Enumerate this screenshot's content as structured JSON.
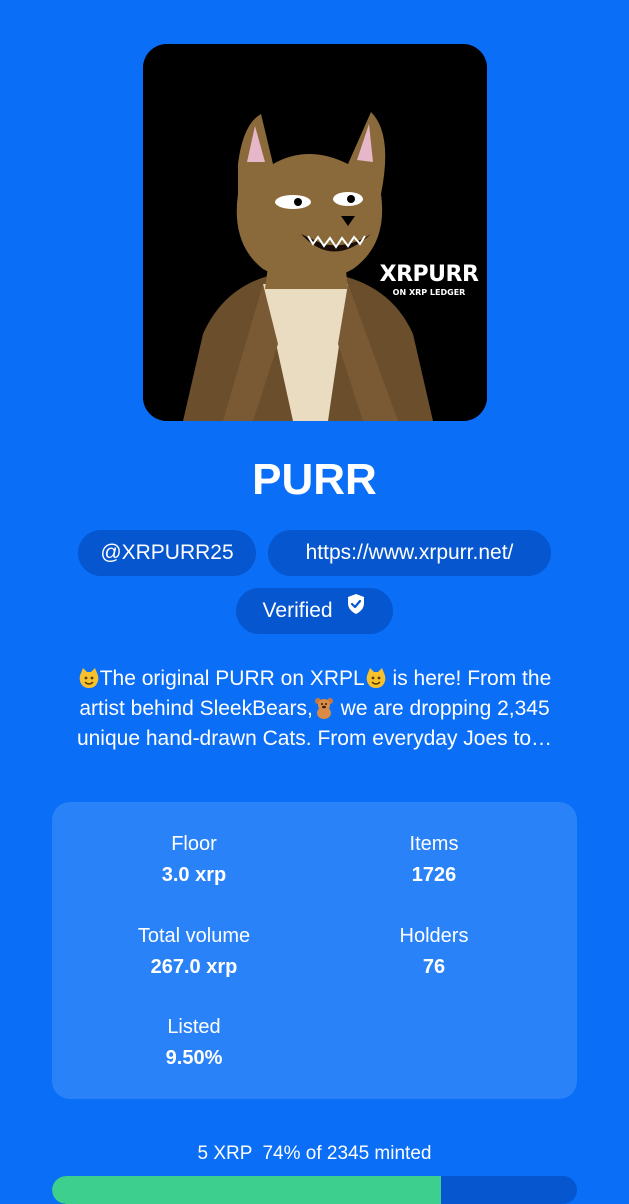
{
  "collection": {
    "image_alt": "XRPURR cat in jacket",
    "image_brand": "XRPURR",
    "image_brand_sub": "ON XRP LEDGER",
    "title": "PURR",
    "twitter": "@XRPURR25",
    "website": "https://www.xrpurr.net/",
    "verified_label": "Verified",
    "description": {
      "line1_a": "The original PURR on XRPL",
      "line1_b": " is here! From the",
      "line2_a": "artist behind SleekBears,",
      "line2_b": " we are dropping 2,345",
      "line3": "unique hand-drawn Cats. From everyday Joes to…"
    }
  },
  "stats": {
    "floor": {
      "label": "Floor",
      "value": "3.0 xrp"
    },
    "items": {
      "label": "Items",
      "value": "1726"
    },
    "volume": {
      "label": "Total volume",
      "value": "267.0 xrp"
    },
    "holders": {
      "label": "Holders",
      "value": "76"
    },
    "listed": {
      "label": "Listed",
      "value": "9.50%"
    }
  },
  "mint": {
    "price": "5 XRP",
    "progress_text": "74% of 2345 minted",
    "progress_fraction": 0.74
  },
  "colors": {
    "background": "#0a6ef7",
    "pill": "#0556cf",
    "card": "#2a82f9",
    "progress_fill": "#3dcf8e"
  },
  "icons": {
    "verified": "shield-check-icon",
    "emoji_cat": "smiling-cat-face-icon",
    "emoji_bear": "teddy-bear-icon"
  }
}
